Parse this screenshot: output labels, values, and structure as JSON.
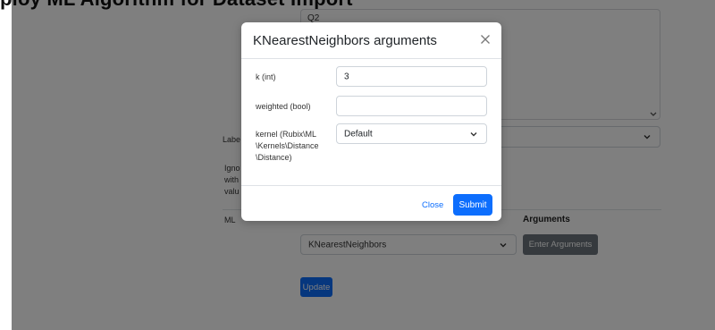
{
  "page": {
    "heading": "ploy ML Algorithm for Dataset Import"
  },
  "background": {
    "features_textarea": {
      "visible_text": "Q2"
    },
    "label_field": {
      "label": "Labe",
      "value": ""
    },
    "ignore_field": {
      "label_lines": [
        "Igno",
        "with",
        "valu"
      ]
    },
    "ml_section": {
      "label": "ML",
      "arguments_header": "Arguments",
      "algorithm_select": {
        "value": "KNearestNeighbors"
      },
      "enter_arguments_button": "Enter Arguments"
    },
    "update_button": "Update"
  },
  "modal": {
    "title": "KNearestNeighbors arguments",
    "close_icon": "close-icon",
    "fields": [
      {
        "label_lines": [
          "k (int)"
        ],
        "value": "3",
        "type": "input"
      },
      {
        "label_lines": [
          "weighted (bool)"
        ],
        "value": "",
        "type": "input"
      },
      {
        "label_lines": [
          "kernel (Rubix\\ML",
          "\\Kernels\\Distance",
          "\\Distance)"
        ],
        "value": "Default",
        "type": "select"
      }
    ],
    "close_label": "Close",
    "submit_label": "Submit"
  },
  "colors": {
    "primary": "#0d6efd",
    "secondary": "#6c757d",
    "backdrop": "rgba(0,0,0,0.5)"
  }
}
